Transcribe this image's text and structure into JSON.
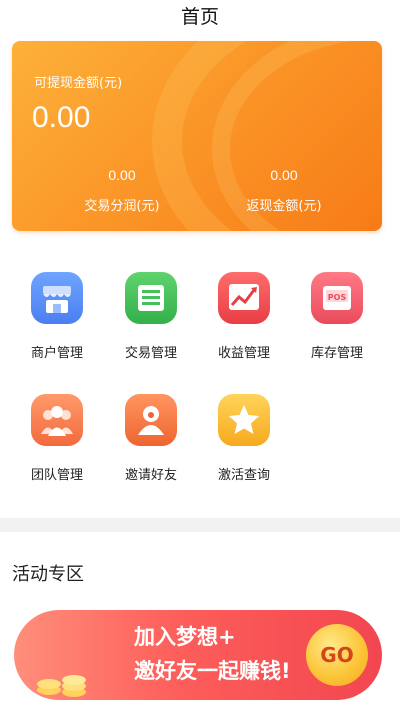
{
  "header": {
    "title": "首页"
  },
  "card": {
    "withdrawable_label": "可提现金额(元)",
    "withdrawable_value": "0.00",
    "profit_value": "0.00",
    "profit_label": "交易分润(元)",
    "cashback_value": "0.00",
    "cashback_label": "返现金额(元)"
  },
  "menu": [
    {
      "label": "商户管理",
      "icon": "merchant-icon",
      "color": "#5b8ef5"
    },
    {
      "label": "交易管理",
      "icon": "transaction-icon",
      "color": "#3fbf5a"
    },
    {
      "label": "收益管理",
      "icon": "revenue-chart-icon",
      "color": "#f05050"
    },
    {
      "label": "库存管理",
      "icon": "pos-icon",
      "color": "#f25c6d"
    },
    {
      "label": "团队管理",
      "icon": "team-icon",
      "color": "#f47a4e"
    },
    {
      "label": "邀请好友",
      "icon": "invite-icon",
      "color": "#f27e3e"
    },
    {
      "label": "激活查询",
      "icon": "star-icon",
      "color": "#f8b72b"
    }
  ],
  "section": {
    "title": "活动专区"
  },
  "banner": {
    "line1": "加入梦想+",
    "line2": "邀好友一起赚钱!",
    "go_label": "GO"
  }
}
